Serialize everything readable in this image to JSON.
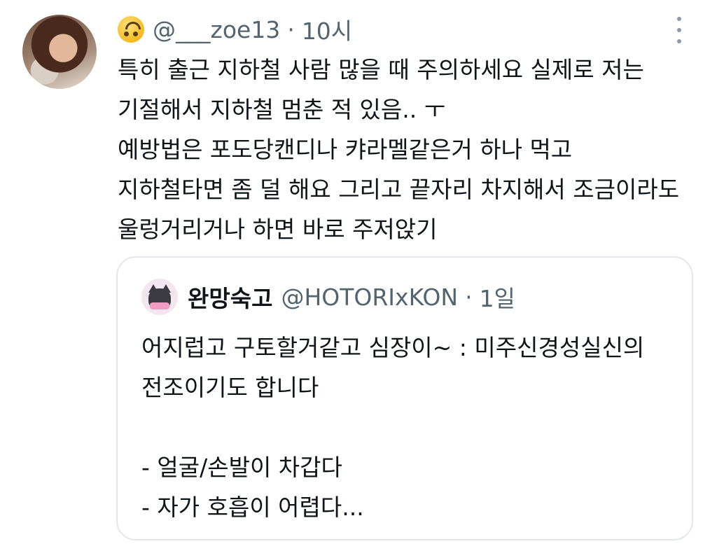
{
  "tweet": {
    "handle": "@___zoe13",
    "separator": "·",
    "time": "10시",
    "lines": [
      "특히 출근 지하철 사람 많을 때 주의하세요 실제로 저는",
      "기절해서 지하철 멈춘 적 있음.. ㅜ",
      "예방법은 포도당캔디나 캬라멜같은거 하나 먹고",
      "지하철타면 좀 덜 해요 그리고 끝자리 차지해서 조금이라도",
      "울렁거리거나 하면 바로 주저앉기"
    ]
  },
  "quote": {
    "name": "완망숙고",
    "handle": "@HOTORIxKON",
    "separator": "·",
    "time": "1일",
    "lines": [
      "어지럽고 구토할거같고 심장이~ : 미주신경성실신의",
      "전조이기도 합니다",
      "",
      "- 얼굴/손발이 차갑다",
      "- 자가 호흡이 어렵다..."
    ]
  }
}
